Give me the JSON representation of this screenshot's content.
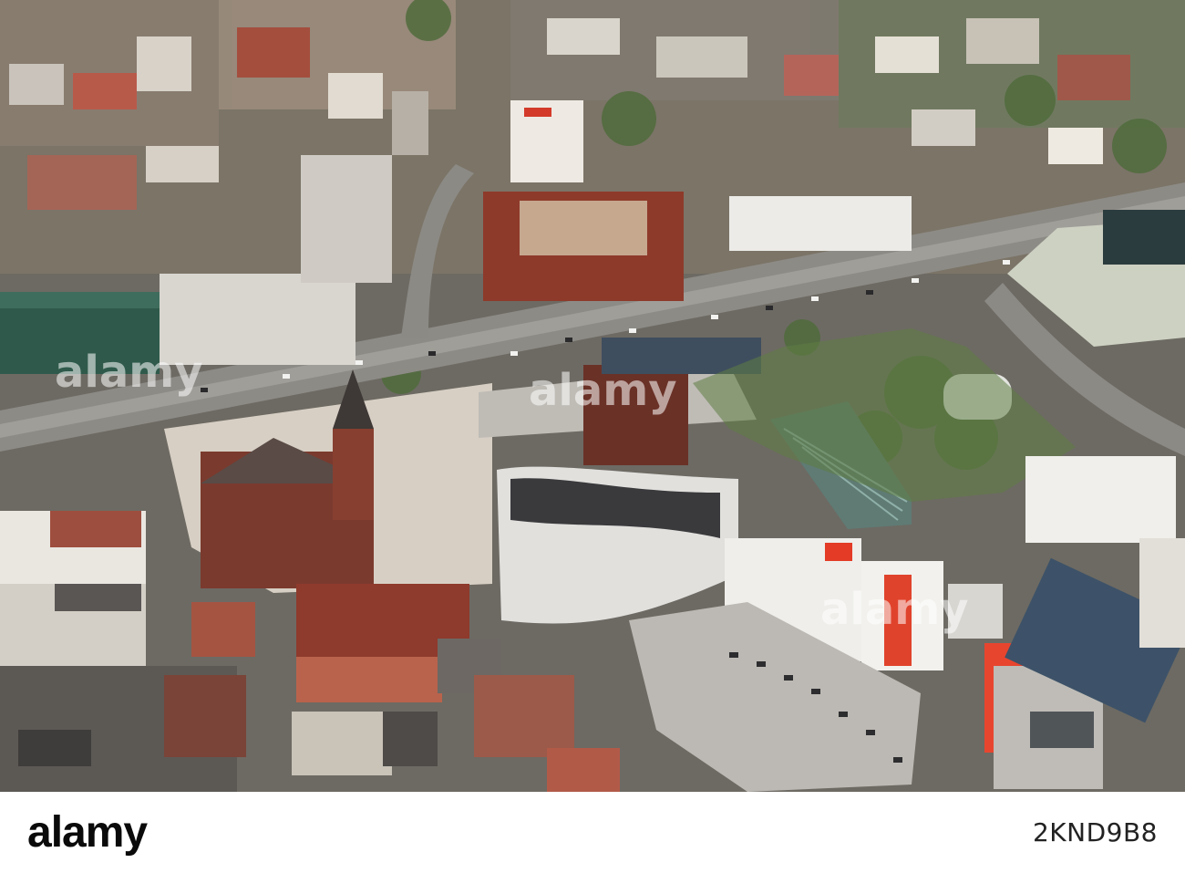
{
  "photo": {
    "subject": "aerial-city-view",
    "watermark_text": "alamy"
  },
  "stock_bar": {
    "logo_text": "alamy",
    "image_id": "2KND9B8"
  }
}
